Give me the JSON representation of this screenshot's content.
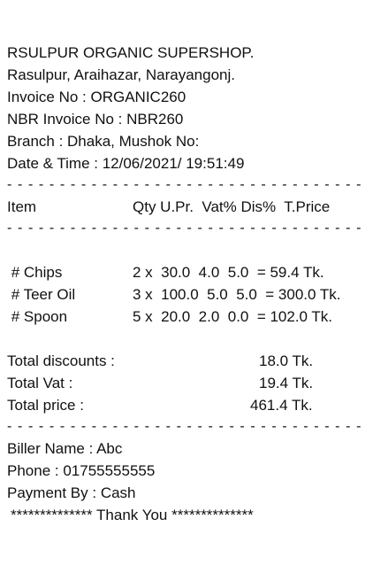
{
  "store": {
    "name": "RSULPUR ORGANIC SUPERSHOP.",
    "address": "Rasulpur, Araihazar, Narayangonj.",
    "invoice_no": "Invoice No : ORGANIC260",
    "nbr_invoice_no": "NBR Invoice No : NBR260",
    "branch": "Branch : Dhaka, Mushok No:",
    "datetime": "Date & Time : 12/06/2021/ 19:51:49"
  },
  "separator": "- - - - - - - - - - - - - - - - - - - - - - - - - - - - - - - - - -",
  "table": {
    "header_item": "Item",
    "header_cols": "Qty U.Pr.  Vat% Dis%  T.Price",
    "rows": [
      {
        "item": " # Chips",
        "detail": "2 x  30.0  4.0  5.0  = 59.4 Tk."
      },
      {
        "item": " # Teer Oil",
        "detail": "3 x  100.0  5.0  5.0  = 300.0 Tk."
      },
      {
        "item": " # Spoon",
        "detail": "5 x  20.0  2.0  0.0  = 102.0 Tk."
      }
    ]
  },
  "totals": {
    "discount_label": "Total discounts :",
    "discount_value": "18.0 Tk.",
    "vat_label": "Total Vat :",
    "vat_value": "19.4 Tk.",
    "price_label": "Total price :",
    "price_value": "461.4 Tk."
  },
  "footer": {
    "biller": "Biller Name : Abc",
    "phone": "Phone : 01755555555",
    "payment": "Payment By : Cash",
    "thanks": "************** Thank You **************"
  }
}
